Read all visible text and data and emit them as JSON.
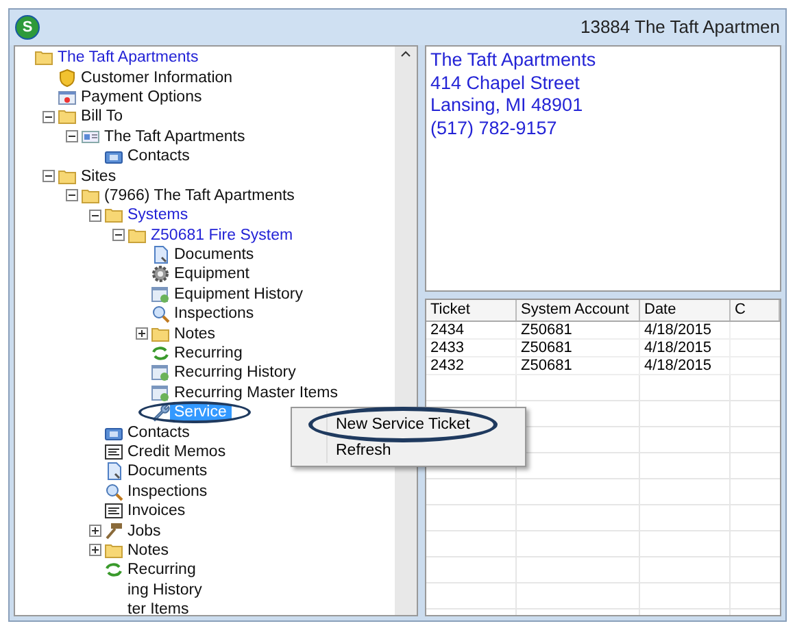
{
  "window": {
    "logo_letter": "S",
    "title": "13884  The Taft Apartmen"
  },
  "tree": [
    {
      "label": "The Taft Apartments",
      "kind": "folder",
      "highlighted": true,
      "selected": false,
      "children": [
        {
          "label": "Customer Information",
          "kind": "shield",
          "highlighted": false,
          "selected": false
        },
        {
          "label": "Payment Options",
          "kind": "card",
          "highlighted": false,
          "selected": false
        },
        {
          "label": "Bill To",
          "kind": "folder",
          "highlighted": false,
          "selected": false,
          "expanded": true,
          "children": [
            {
              "label": "The Taft Apartments",
              "kind": "contact",
              "highlighted": false,
              "selected": false,
              "expanded": true,
              "children": [
                {
                  "label": "Contacts",
                  "kind": "phone",
                  "highlighted": false,
                  "selected": false
                }
              ]
            }
          ]
        },
        {
          "label": "Sites",
          "kind": "folder",
          "highlighted": false,
          "selected": false,
          "expanded": true,
          "children": [
            {
              "label": "(7966) The Taft Apartments",
              "kind": "folder",
              "highlighted": false,
              "selected": false,
              "expanded": true,
              "children": [
                {
                  "label": "Systems",
                  "kind": "folder",
                  "highlighted": true,
                  "selected": false,
                  "expanded": true,
                  "children": [
                    {
                      "label": "Z50681  Fire System",
                      "kind": "folder",
                      "highlighted": true,
                      "selected": false,
                      "expanded": true,
                      "children": [
                        {
                          "label": "Documents",
                          "kind": "document",
                          "highlighted": false,
                          "selected": false
                        },
                        {
                          "label": "Equipment",
                          "kind": "gear",
                          "highlighted": false,
                          "selected": false
                        },
                        {
                          "label": "Equipment History",
                          "kind": "history",
                          "highlighted": false,
                          "selected": false
                        },
                        {
                          "label": "Inspections",
                          "kind": "magnifier",
                          "highlighted": false,
                          "selected": false
                        },
                        {
                          "label": "Notes",
                          "kind": "folder",
                          "highlighted": false,
                          "selected": false,
                          "expanded": false
                        },
                        {
                          "label": "Recurring",
                          "kind": "refresh",
                          "highlighted": false,
                          "selected": false
                        },
                        {
                          "label": "Recurring History",
                          "kind": "history",
                          "highlighted": false,
                          "selected": false
                        },
                        {
                          "label": "Recurring Master Items",
                          "kind": "history",
                          "highlighted": false,
                          "selected": false
                        },
                        {
                          "label": "Service",
                          "kind": "wrench",
                          "highlighted": false,
                          "selected": true,
                          "circled": true
                        }
                      ]
                    }
                  ]
                },
                {
                  "label": "Contacts",
                  "kind": "phone",
                  "highlighted": false,
                  "selected": false
                },
                {
                  "label": "Credit Memos",
                  "kind": "memo",
                  "highlighted": false,
                  "selected": false
                },
                {
                  "label": "Documents",
                  "kind": "document",
                  "highlighted": false,
                  "selected": false
                },
                {
                  "label": "Inspections",
                  "kind": "magnifier",
                  "highlighted": false,
                  "selected": false
                },
                {
                  "label": "Invoices",
                  "kind": "memo",
                  "highlighted": false,
                  "selected": false
                },
                {
                  "label": "Jobs",
                  "kind": "hammer",
                  "highlighted": false,
                  "selected": false,
                  "expanded": false
                },
                {
                  "label": "Notes",
                  "kind": "folder",
                  "highlighted": false,
                  "selected": false,
                  "expanded": false
                },
                {
                  "label": "Recurring",
                  "kind": "refresh",
                  "highlighted": false,
                  "selected": false
                },
                {
                  "label": "ing History",
                  "kind": "none",
                  "highlighted": false,
                  "selected": false
                },
                {
                  "label": "ter Items",
                  "kind": "none",
                  "highlighted": false,
                  "selected": false
                }
              ]
            }
          ]
        }
      ]
    }
  ],
  "info": [
    "The Taft Apartments",
    "414 Chapel Street",
    "Lansing, MI 48901",
    "(517) 782-9157"
  ],
  "grid": {
    "columns": [
      "Ticket",
      "System Account",
      "Date",
      "C"
    ],
    "rows": [
      [
        "2434",
        "Z50681",
        "4/18/2015"
      ],
      [
        "2433",
        "Z50681",
        "4/18/2015"
      ],
      [
        "2432",
        "Z50681",
        "4/18/2015"
      ]
    ]
  },
  "context_menu": [
    {
      "label": "New Service Ticket",
      "circled": true
    },
    {
      "label": "Refresh",
      "circled": false
    }
  ]
}
